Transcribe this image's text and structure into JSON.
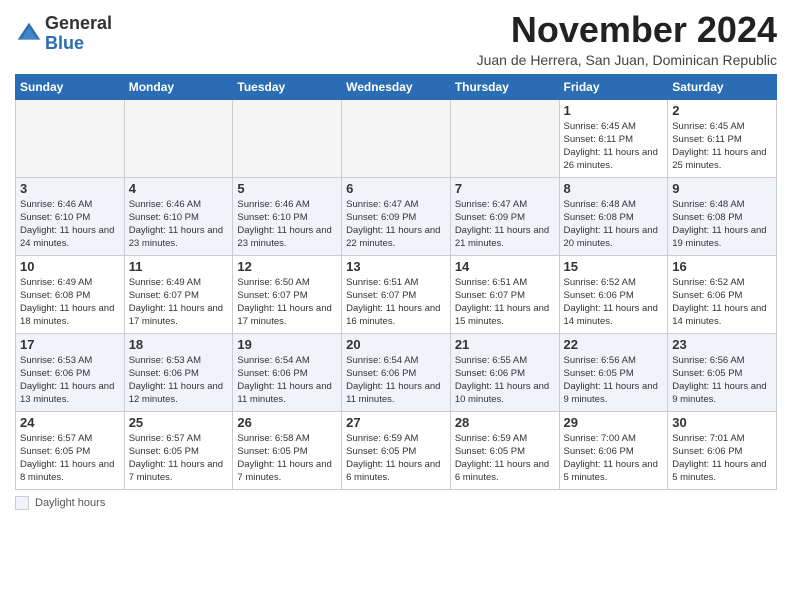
{
  "logo": {
    "general": "General",
    "blue": "Blue"
  },
  "title": "November 2024",
  "location": "Juan de Herrera, San Juan, Dominican Republic",
  "days_of_week": [
    "Sunday",
    "Monday",
    "Tuesday",
    "Wednesday",
    "Thursday",
    "Friday",
    "Saturday"
  ],
  "legend": {
    "box_label": "Daylight hours"
  },
  "weeks": [
    [
      {
        "date": "",
        "info": ""
      },
      {
        "date": "",
        "info": ""
      },
      {
        "date": "",
        "info": ""
      },
      {
        "date": "",
        "info": ""
      },
      {
        "date": "",
        "info": ""
      },
      {
        "date": "1",
        "info": "Sunrise: 6:45 AM\nSunset: 6:11 PM\nDaylight: 11 hours and 26 minutes."
      },
      {
        "date": "2",
        "info": "Sunrise: 6:45 AM\nSunset: 6:11 PM\nDaylight: 11 hours and 25 minutes."
      }
    ],
    [
      {
        "date": "3",
        "info": "Sunrise: 6:46 AM\nSunset: 6:10 PM\nDaylight: 11 hours and 24 minutes."
      },
      {
        "date": "4",
        "info": "Sunrise: 6:46 AM\nSunset: 6:10 PM\nDaylight: 11 hours and 23 minutes."
      },
      {
        "date": "5",
        "info": "Sunrise: 6:46 AM\nSunset: 6:10 PM\nDaylight: 11 hours and 23 minutes."
      },
      {
        "date": "6",
        "info": "Sunrise: 6:47 AM\nSunset: 6:09 PM\nDaylight: 11 hours and 22 minutes."
      },
      {
        "date": "7",
        "info": "Sunrise: 6:47 AM\nSunset: 6:09 PM\nDaylight: 11 hours and 21 minutes."
      },
      {
        "date": "8",
        "info": "Sunrise: 6:48 AM\nSunset: 6:08 PM\nDaylight: 11 hours and 20 minutes."
      },
      {
        "date": "9",
        "info": "Sunrise: 6:48 AM\nSunset: 6:08 PM\nDaylight: 11 hours and 19 minutes."
      }
    ],
    [
      {
        "date": "10",
        "info": "Sunrise: 6:49 AM\nSunset: 6:08 PM\nDaylight: 11 hours and 18 minutes."
      },
      {
        "date": "11",
        "info": "Sunrise: 6:49 AM\nSunset: 6:07 PM\nDaylight: 11 hours and 17 minutes."
      },
      {
        "date": "12",
        "info": "Sunrise: 6:50 AM\nSunset: 6:07 PM\nDaylight: 11 hours and 17 minutes."
      },
      {
        "date": "13",
        "info": "Sunrise: 6:51 AM\nSunset: 6:07 PM\nDaylight: 11 hours and 16 minutes."
      },
      {
        "date": "14",
        "info": "Sunrise: 6:51 AM\nSunset: 6:07 PM\nDaylight: 11 hours and 15 minutes."
      },
      {
        "date": "15",
        "info": "Sunrise: 6:52 AM\nSunset: 6:06 PM\nDaylight: 11 hours and 14 minutes."
      },
      {
        "date": "16",
        "info": "Sunrise: 6:52 AM\nSunset: 6:06 PM\nDaylight: 11 hours and 14 minutes."
      }
    ],
    [
      {
        "date": "17",
        "info": "Sunrise: 6:53 AM\nSunset: 6:06 PM\nDaylight: 11 hours and 13 minutes."
      },
      {
        "date": "18",
        "info": "Sunrise: 6:53 AM\nSunset: 6:06 PM\nDaylight: 11 hours and 12 minutes."
      },
      {
        "date": "19",
        "info": "Sunrise: 6:54 AM\nSunset: 6:06 PM\nDaylight: 11 hours and 11 minutes."
      },
      {
        "date": "20",
        "info": "Sunrise: 6:54 AM\nSunset: 6:06 PM\nDaylight: 11 hours and 11 minutes."
      },
      {
        "date": "21",
        "info": "Sunrise: 6:55 AM\nSunset: 6:06 PM\nDaylight: 11 hours and 10 minutes."
      },
      {
        "date": "22",
        "info": "Sunrise: 6:56 AM\nSunset: 6:05 PM\nDaylight: 11 hours and 9 minutes."
      },
      {
        "date": "23",
        "info": "Sunrise: 6:56 AM\nSunset: 6:05 PM\nDaylight: 11 hours and 9 minutes."
      }
    ],
    [
      {
        "date": "24",
        "info": "Sunrise: 6:57 AM\nSunset: 6:05 PM\nDaylight: 11 hours and 8 minutes."
      },
      {
        "date": "25",
        "info": "Sunrise: 6:57 AM\nSunset: 6:05 PM\nDaylight: 11 hours and 7 minutes."
      },
      {
        "date": "26",
        "info": "Sunrise: 6:58 AM\nSunset: 6:05 PM\nDaylight: 11 hours and 7 minutes."
      },
      {
        "date": "27",
        "info": "Sunrise: 6:59 AM\nSunset: 6:05 PM\nDaylight: 11 hours and 6 minutes."
      },
      {
        "date": "28",
        "info": "Sunrise: 6:59 AM\nSunset: 6:05 PM\nDaylight: 11 hours and 6 minutes."
      },
      {
        "date": "29",
        "info": "Sunrise: 7:00 AM\nSunset: 6:06 PM\nDaylight: 11 hours and 5 minutes."
      },
      {
        "date": "30",
        "info": "Sunrise: 7:01 AM\nSunset: 6:06 PM\nDaylight: 11 hours and 5 minutes."
      }
    ]
  ]
}
